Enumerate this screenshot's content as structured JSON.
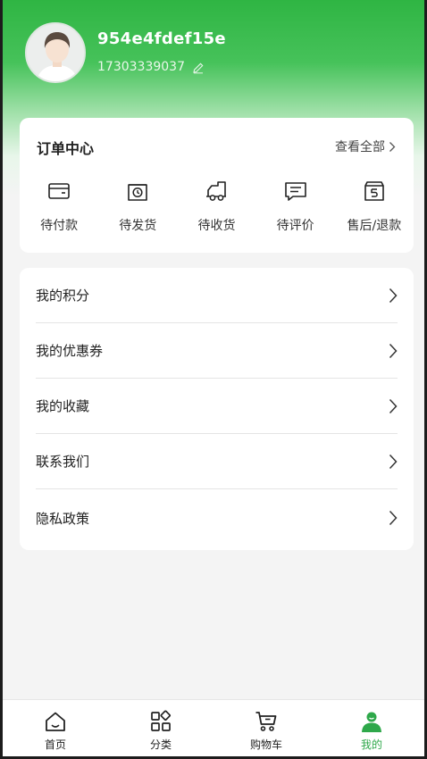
{
  "profile": {
    "username": "954e4fdef15e",
    "phone": "17303339037"
  },
  "orders": {
    "title": "订单中心",
    "view_all": "查看全部",
    "items": [
      {
        "label": "待付款",
        "icon": "wallet-icon"
      },
      {
        "label": "待发货",
        "icon": "clock-box-icon"
      },
      {
        "label": "待收货",
        "icon": "truck-icon"
      },
      {
        "label": "待评价",
        "icon": "comment-icon"
      },
      {
        "label": "售后/退款",
        "icon": "refund-icon"
      }
    ]
  },
  "menu": {
    "items": [
      {
        "label": "我的积分"
      },
      {
        "label": "我的优惠券"
      },
      {
        "label": "我的收藏"
      },
      {
        "label": "联系我们"
      },
      {
        "label": "隐私政策"
      }
    ]
  },
  "tabbar": {
    "items": [
      {
        "label": "首页",
        "icon": "home-icon"
      },
      {
        "label": "分类",
        "icon": "grid-icon"
      },
      {
        "label": "购物车",
        "icon": "cart-icon"
      },
      {
        "label": "我的",
        "icon": "user-icon",
        "active": true
      }
    ],
    "active_color": "#2ea84a"
  },
  "colors": {
    "brand_green": "#2fb543"
  }
}
